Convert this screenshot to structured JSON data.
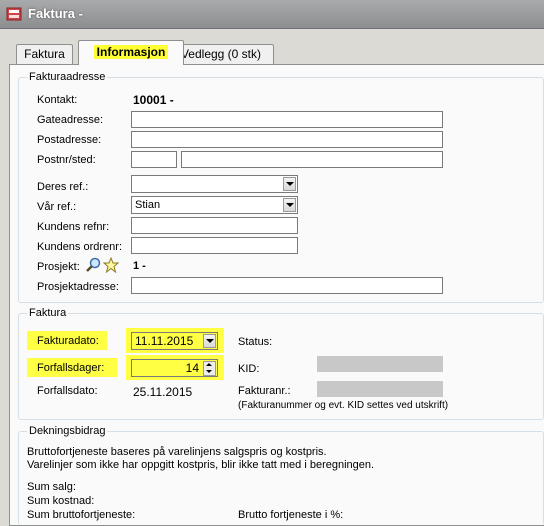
{
  "window": {
    "title": "Faktura -"
  },
  "tabs": [
    {
      "label": "Faktura"
    },
    {
      "label": "Informasjon"
    },
    {
      "label": "Vedlegg (0 stk)"
    }
  ],
  "fakturaadresse": {
    "legend": "Fakturaadresse",
    "kontakt_label": "Kontakt:",
    "kontakt_value": "10001 -",
    "gateadresse_label": "Gateadresse:",
    "gateadresse_value": "",
    "postadresse_label": "Postadresse:",
    "postadresse_value": "",
    "postnr_label": "Postnr/sted:",
    "postnr_value": "",
    "sted_value": "",
    "deres_ref_label": "Deres ref.:",
    "deres_ref_value": "",
    "var_ref_label": "Vår ref.:",
    "var_ref_value": "Stian",
    "kundens_refnr_label": "Kundens refnr:",
    "kundens_refnr_value": "",
    "kundens_ordrenr_label": "Kundens ordrenr:",
    "kundens_ordrenr_value": "",
    "prosjekt_label": "Prosjekt:",
    "prosjekt_value": "1 -",
    "prosjektadresse_label": "Prosjektadresse:",
    "prosjektadresse_value": ""
  },
  "faktura": {
    "legend": "Faktura",
    "fakturadato_label": "Fakturadato:",
    "fakturadato_value": "11.11.2015",
    "forfallsdager_label": "Forfallsdager:",
    "forfallsdager_value": "14",
    "forfallsdato_label": "Forfallsdato:",
    "forfallsdato_value": "25.11.2015",
    "status_label": "Status:",
    "kid_label": "KID:",
    "fakturanr_label": "Fakturanr.:",
    "note": "(Fakturanummer og evt. KID settes ved utskrift)"
  },
  "dekningsbidrag": {
    "legend": "Dekningsbidrag",
    "line1": "Bruttofortjeneste baseres på varelinjens salgspris og kostpris.",
    "line2": "Varelinjer som ikke har oppgitt kostpris, blir ikke tatt med i beregningen.",
    "sum_salg_label": "Sum salg:",
    "sum_kostnad_label": "Sum kostnad:",
    "sum_brutto_label": "Sum bruttofortjeneste:",
    "brutto_pct_label": "Brutto fortjeneste i %:"
  },
  "colors": {
    "highlight": "#ffff33",
    "panel": "#fafafa",
    "chrome": "#dcdad5"
  },
  "icons": {
    "app": "document-icon",
    "search": "magnifier-icon",
    "favorite": "star-icon"
  }
}
